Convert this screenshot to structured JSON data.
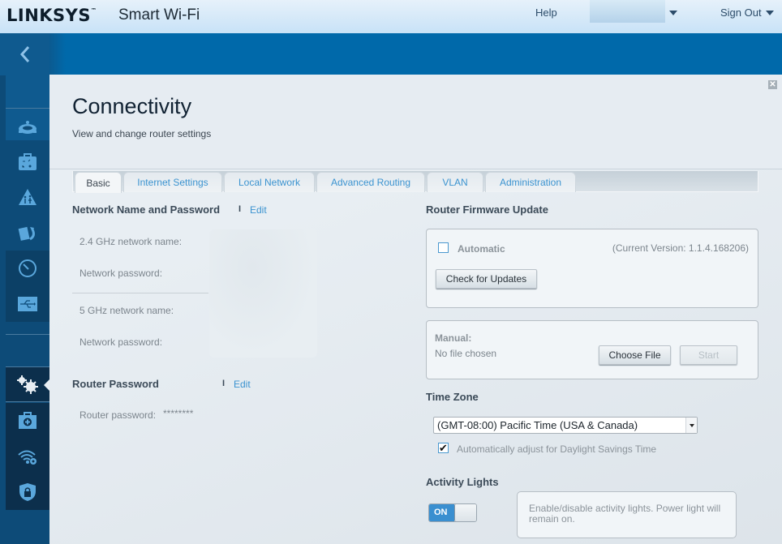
{
  "header": {
    "brand": "LINKSYS",
    "trademark": "™",
    "product": "Smart Wi-Fi",
    "help_label": "Help",
    "signout_label": "Sign Out"
  },
  "sidebar": {
    "back_icon": "chevron-left-icon",
    "items": [
      {
        "name": "device-list",
        "icon": "router-icon"
      },
      {
        "name": "widgets",
        "icon": "toolbox-icon"
      },
      {
        "name": "parental-controls",
        "icon": "parental-warning-icon"
      },
      {
        "name": "media-prioritization",
        "icon": "media-refresh-icon"
      },
      {
        "name": "speed-test",
        "icon": "speedometer-icon"
      },
      {
        "name": "external-storage",
        "icon": "usb-icon"
      },
      {
        "name": "connectivity",
        "icon": "gears-icon",
        "active": true
      },
      {
        "name": "troubleshooting",
        "icon": "medkit-icon"
      },
      {
        "name": "wireless",
        "icon": "wifi-gear-icon"
      },
      {
        "name": "security",
        "icon": "shield-lock-icon"
      }
    ]
  },
  "page": {
    "title": "Connectivity",
    "subtitle": "View and change router settings",
    "close_label": "✕"
  },
  "tabs": [
    {
      "label": "Basic",
      "active": true
    },
    {
      "label": "Internet Settings"
    },
    {
      "label": "Local Network"
    },
    {
      "label": "Advanced Routing"
    },
    {
      "label": "VLAN"
    },
    {
      "label": "Administration"
    }
  ],
  "network": {
    "heading": "Network Name and Password",
    "separator": "I",
    "edit_label": "Edit",
    "fields": [
      {
        "label": "2.4 GHz network name:"
      },
      {
        "label": "Network password:"
      },
      {
        "label": "5 GHz network name:"
      },
      {
        "label": "Network password:"
      }
    ]
  },
  "router_password": {
    "heading": "Router Password",
    "separator": "I",
    "edit_label": "Edit",
    "label": "Router password:",
    "value": "********"
  },
  "firmware": {
    "heading": "Router Firmware Update",
    "automatic_label": "Automatic",
    "automatic_checked": false,
    "current_version": "(Current Version: 1.1.4.168206)",
    "check_button": "Check for Updates",
    "manual_label": "Manual:",
    "no_file": "No file chosen",
    "choose_button": "Choose File",
    "start_button": "Start"
  },
  "timezone": {
    "heading": "Time Zone",
    "selected": "(GMT-08:00) Pacific Time (USA & Canada)",
    "dst_label": "Automatically adjust for Daylight Savings Time",
    "dst_checked": true,
    "check_glyph": "✔"
  },
  "activity_lights": {
    "heading": "Activity Lights",
    "toggle_label": "ON",
    "enabled": true,
    "tip": "Enable/disable activity lights. Power light will remain on."
  }
}
